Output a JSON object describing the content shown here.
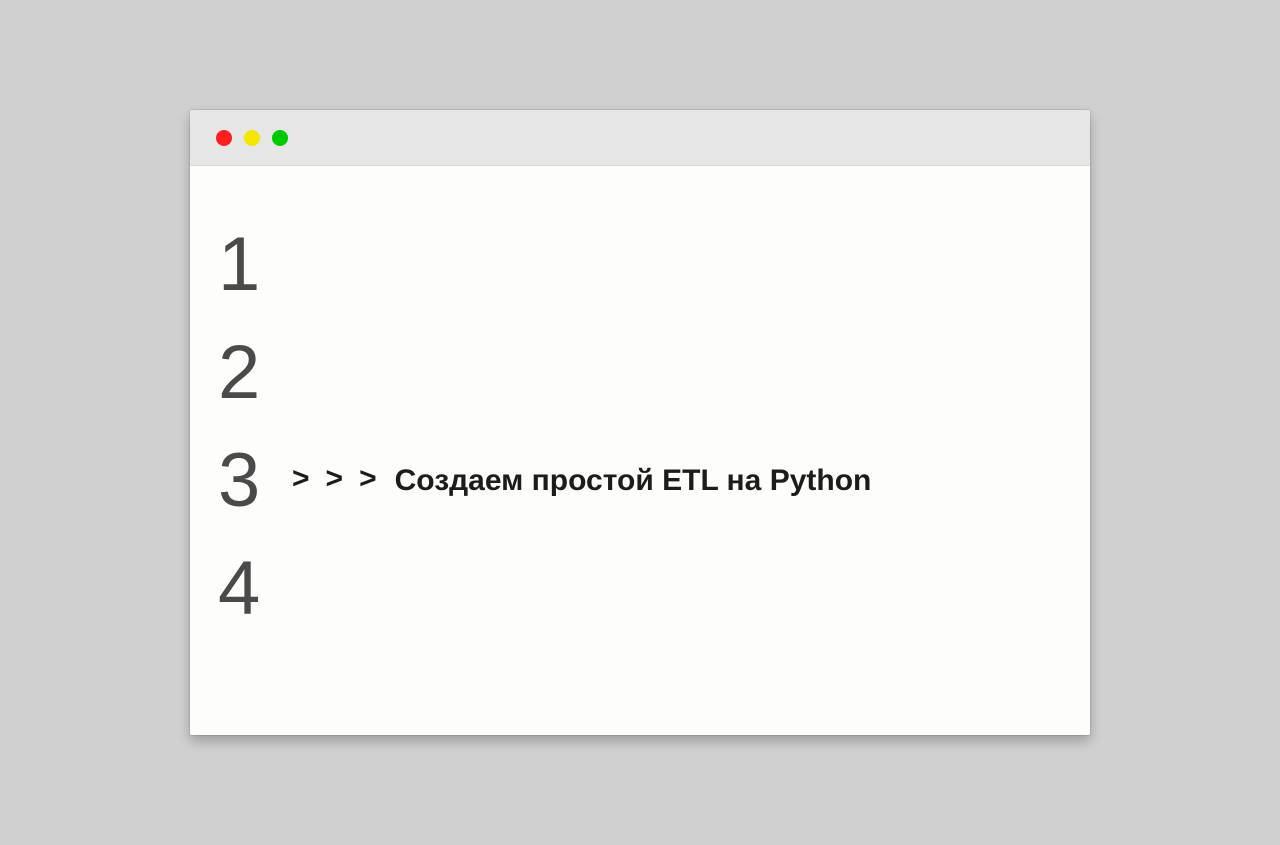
{
  "window": {
    "traffic_lights": {
      "red": "#ff1f1f",
      "yellow": "#f5e600",
      "green": "#00c800"
    }
  },
  "editor": {
    "line_numbers": [
      "1",
      "2",
      "3",
      "4"
    ],
    "prompt": {
      "chevrons": [
        ">",
        ">",
        ">"
      ],
      "text": "Создаем простой ETL на Python"
    },
    "content_line_index": 2
  }
}
